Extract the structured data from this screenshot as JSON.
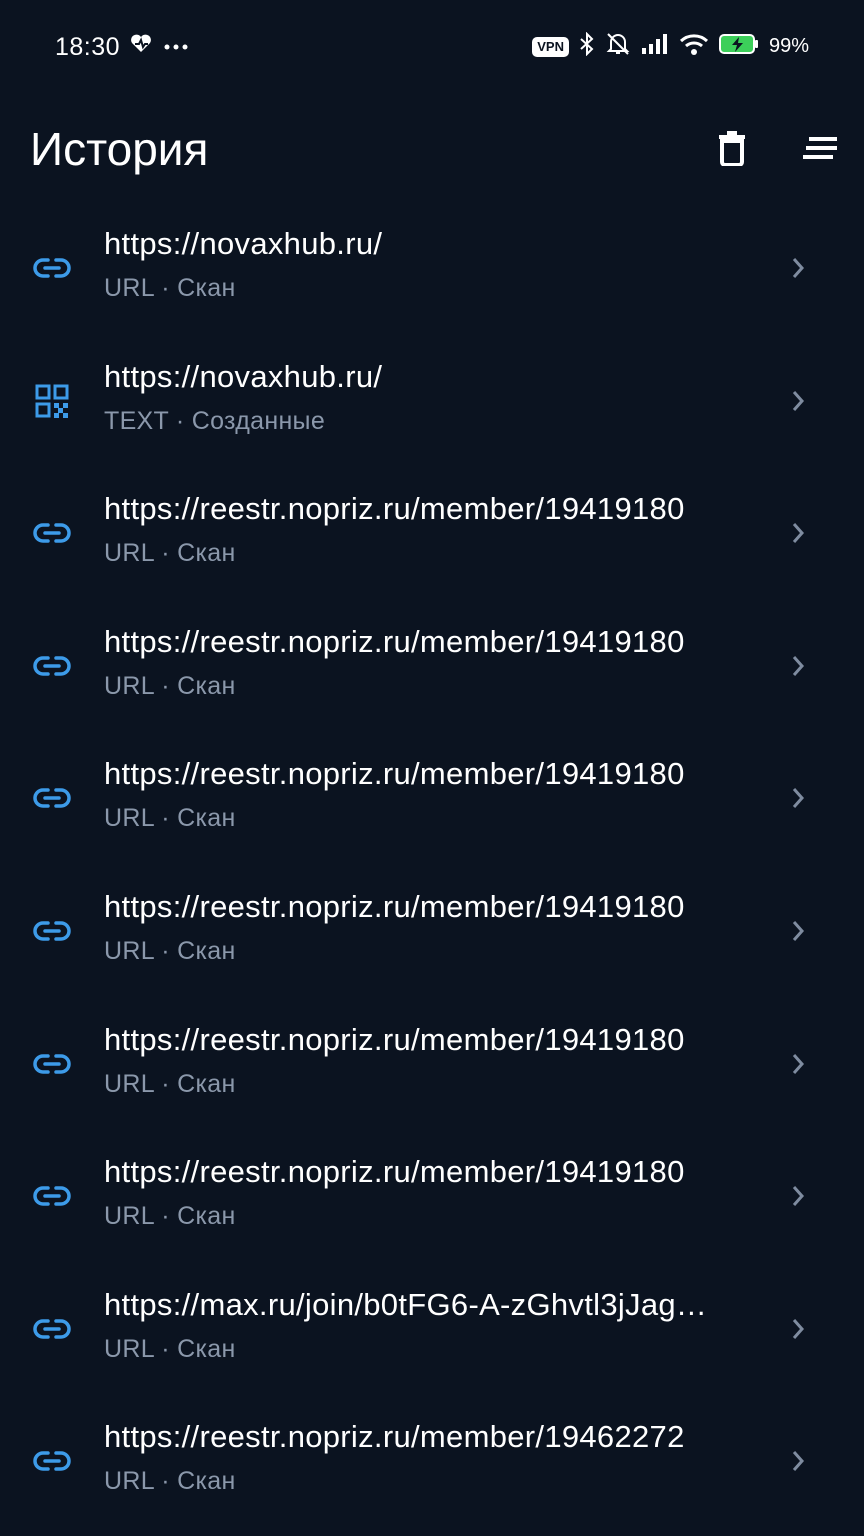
{
  "status_bar": {
    "time": "18:30",
    "vpn_label": "VPN",
    "battery_percent": "99%",
    "icons": [
      "heart-pulse-icon",
      "more-dots-icon",
      "bluetooth-icon",
      "mute-icon",
      "signal-icon",
      "wifi-icon",
      "battery-charging-icon"
    ]
  },
  "header": {
    "title": "История",
    "delete_icon": "trash-icon",
    "sort_icon": "sort-icon"
  },
  "colors": {
    "background": "#0b1320",
    "accent": "#3d9be9",
    "subtitle": "#8b98ab",
    "chevron": "#7f8ca0"
  },
  "history": [
    {
      "icon": "link-icon",
      "title": "https://novaxhub.ru/",
      "subtitle": "URL · Скан"
    },
    {
      "icon": "qr-code-icon",
      "title": "https://novaxhub.ru/",
      "subtitle": "TEXT · Созданные"
    },
    {
      "icon": "link-icon",
      "title": "https://reestr.nopriz.ru/member/19419180",
      "subtitle": "URL · Скан"
    },
    {
      "icon": "link-icon",
      "title": "https://reestr.nopriz.ru/member/19419180",
      "subtitle": "URL · Скан"
    },
    {
      "icon": "link-icon",
      "title": "https://reestr.nopriz.ru/member/19419180",
      "subtitle": "URL · Скан"
    },
    {
      "icon": "link-icon",
      "title": "https://reestr.nopriz.ru/member/19419180",
      "subtitle": "URL · Скан"
    },
    {
      "icon": "link-icon",
      "title": "https://reestr.nopriz.ru/member/19419180",
      "subtitle": "URL · Скан"
    },
    {
      "icon": "link-icon",
      "title": "https://reestr.nopriz.ru/member/19419180",
      "subtitle": "URL · Скан"
    },
    {
      "icon": "link-icon",
      "title": "https://max.ru/join/b0tFG6-A-zGhvtl3jJag…",
      "subtitle": "URL · Скан"
    },
    {
      "icon": "link-icon",
      "title": "https://reestr.nopriz.ru/member/19462272",
      "subtitle": "URL · Скан"
    }
  ]
}
